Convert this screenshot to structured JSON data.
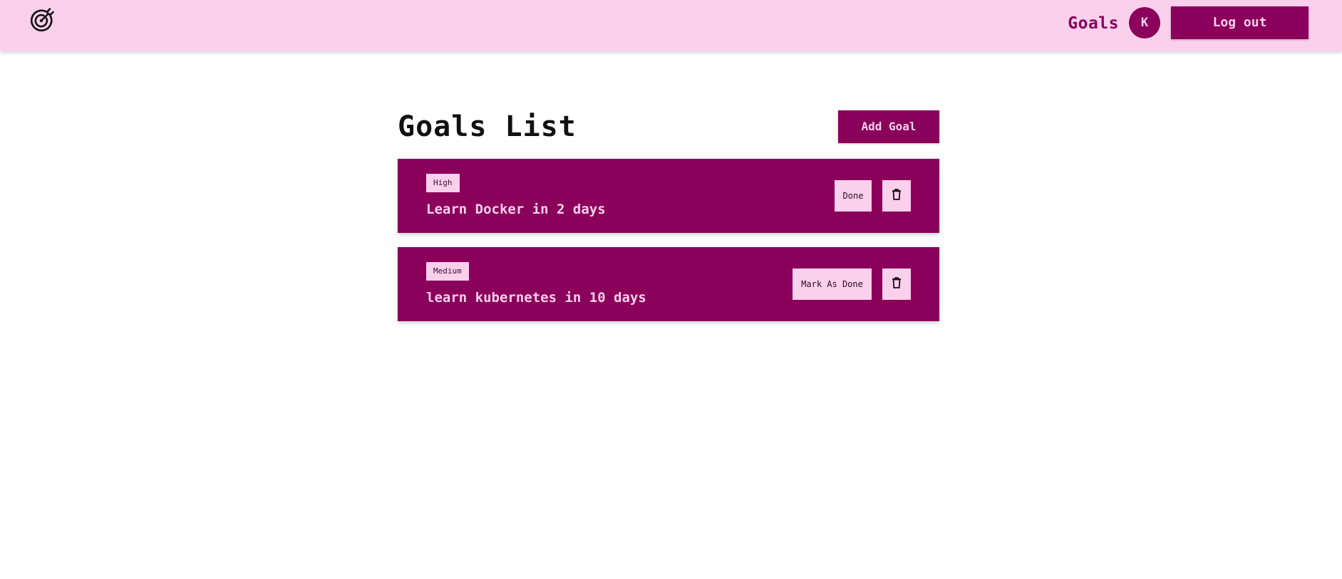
{
  "header": {
    "logo_icon": "target-icon",
    "nav_goals_label": "Goals",
    "avatar_initial": "K",
    "logout_label": "Log out"
  },
  "main": {
    "title": "Goals List",
    "add_goal_label": "Add Goal",
    "goals": [
      {
        "priority": "High",
        "text": "Learn Docker in 2 days",
        "done_label": "Done",
        "delete_icon": "trash-icon"
      },
      {
        "priority": "Medium",
        "text": "learn kubernetes in 10 days",
        "done_label": "Mark As Done",
        "delete_icon": "trash-icon"
      }
    ]
  },
  "colors": {
    "header_bg": "#fbd0ec",
    "accent": "#8a005a",
    "page_bg": "#ffffff"
  }
}
